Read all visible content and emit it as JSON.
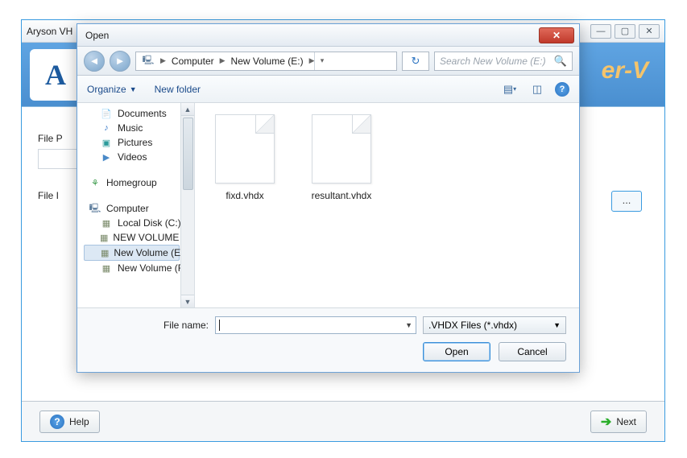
{
  "parent": {
    "title": "Aryson VH",
    "banner_logo": "A",
    "banner_text": "er-V",
    "file_p_label": "File P",
    "file_i_label": "File I",
    "browse_label": "...",
    "help_label": "Help",
    "next_label": "Next"
  },
  "dialog": {
    "title": "Open",
    "breadcrumb": {
      "seg1": "Computer",
      "seg2": "New Volume (E:)"
    },
    "search_placeholder": "Search New Volume (E:)",
    "toolbar": {
      "organize": "Organize",
      "newfolder": "New folder"
    },
    "tree": {
      "documents": "Documents",
      "music": "Music",
      "pictures": "Pictures",
      "videos": "Videos",
      "homegroup": "Homegroup",
      "computer": "Computer",
      "localc": "Local Disk (C:)",
      "newvold": "NEW VOLUME (D",
      "newvole": "New Volume (E:)",
      "newvolf": "New Volume (F:)"
    },
    "files": [
      {
        "name": "fixd.vhdx"
      },
      {
        "name": "resultant.vhdx"
      }
    ],
    "filename_label": "File name:",
    "filetype": ".VHDX Files (*.vhdx)",
    "open_label": "Open",
    "cancel_label": "Cancel"
  }
}
